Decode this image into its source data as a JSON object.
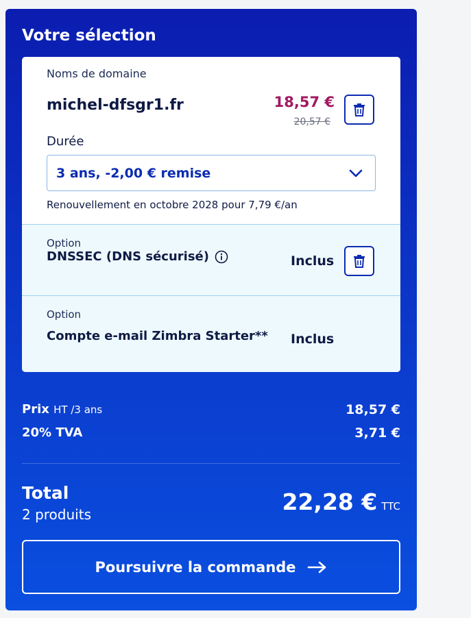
{
  "panel": {
    "title": "Votre sélection"
  },
  "domain_section": {
    "label": "Noms de domaine",
    "domain": "michel-dfsgr1.fr",
    "price_new": "18,57 €",
    "price_old": "20,57 €",
    "duration_label": "Durée",
    "duration_value": "3 ans, -2,00 € remise",
    "renewal_note": "Renouvellement en octobre 2028 pour 7,79 €/an"
  },
  "options": [
    {
      "kicker": "Option",
      "name": "DNSSEC (DNS sécurisé)",
      "status": "Inclus"
    },
    {
      "kicker": "Option",
      "name": "Compte e-mail Zimbra Starter**",
      "status": "Inclus"
    }
  ],
  "summary": {
    "price_label": "Prix",
    "price_sub": "HT /3 ans",
    "price_value": "18,57 €",
    "tva_label": "20% TVA",
    "tva_value": "3,71 €"
  },
  "total": {
    "label": "Total",
    "count": "2 produits",
    "amount": "22,28 €",
    "suffix": "TTC"
  },
  "cta": {
    "label": "Poursuivre la commande"
  },
  "colors": {
    "panel_top": "#0b1db0",
    "panel_bottom": "#0a4fe0",
    "price_accent": "#a01a60",
    "link_blue": "#0b2bb0",
    "option_bg": "#eef9fd"
  },
  "icons": {
    "trash": "trash-icon",
    "info": "info-icon",
    "dropdown": "chevron-down-icon",
    "cta": "arrow-right-icon"
  }
}
